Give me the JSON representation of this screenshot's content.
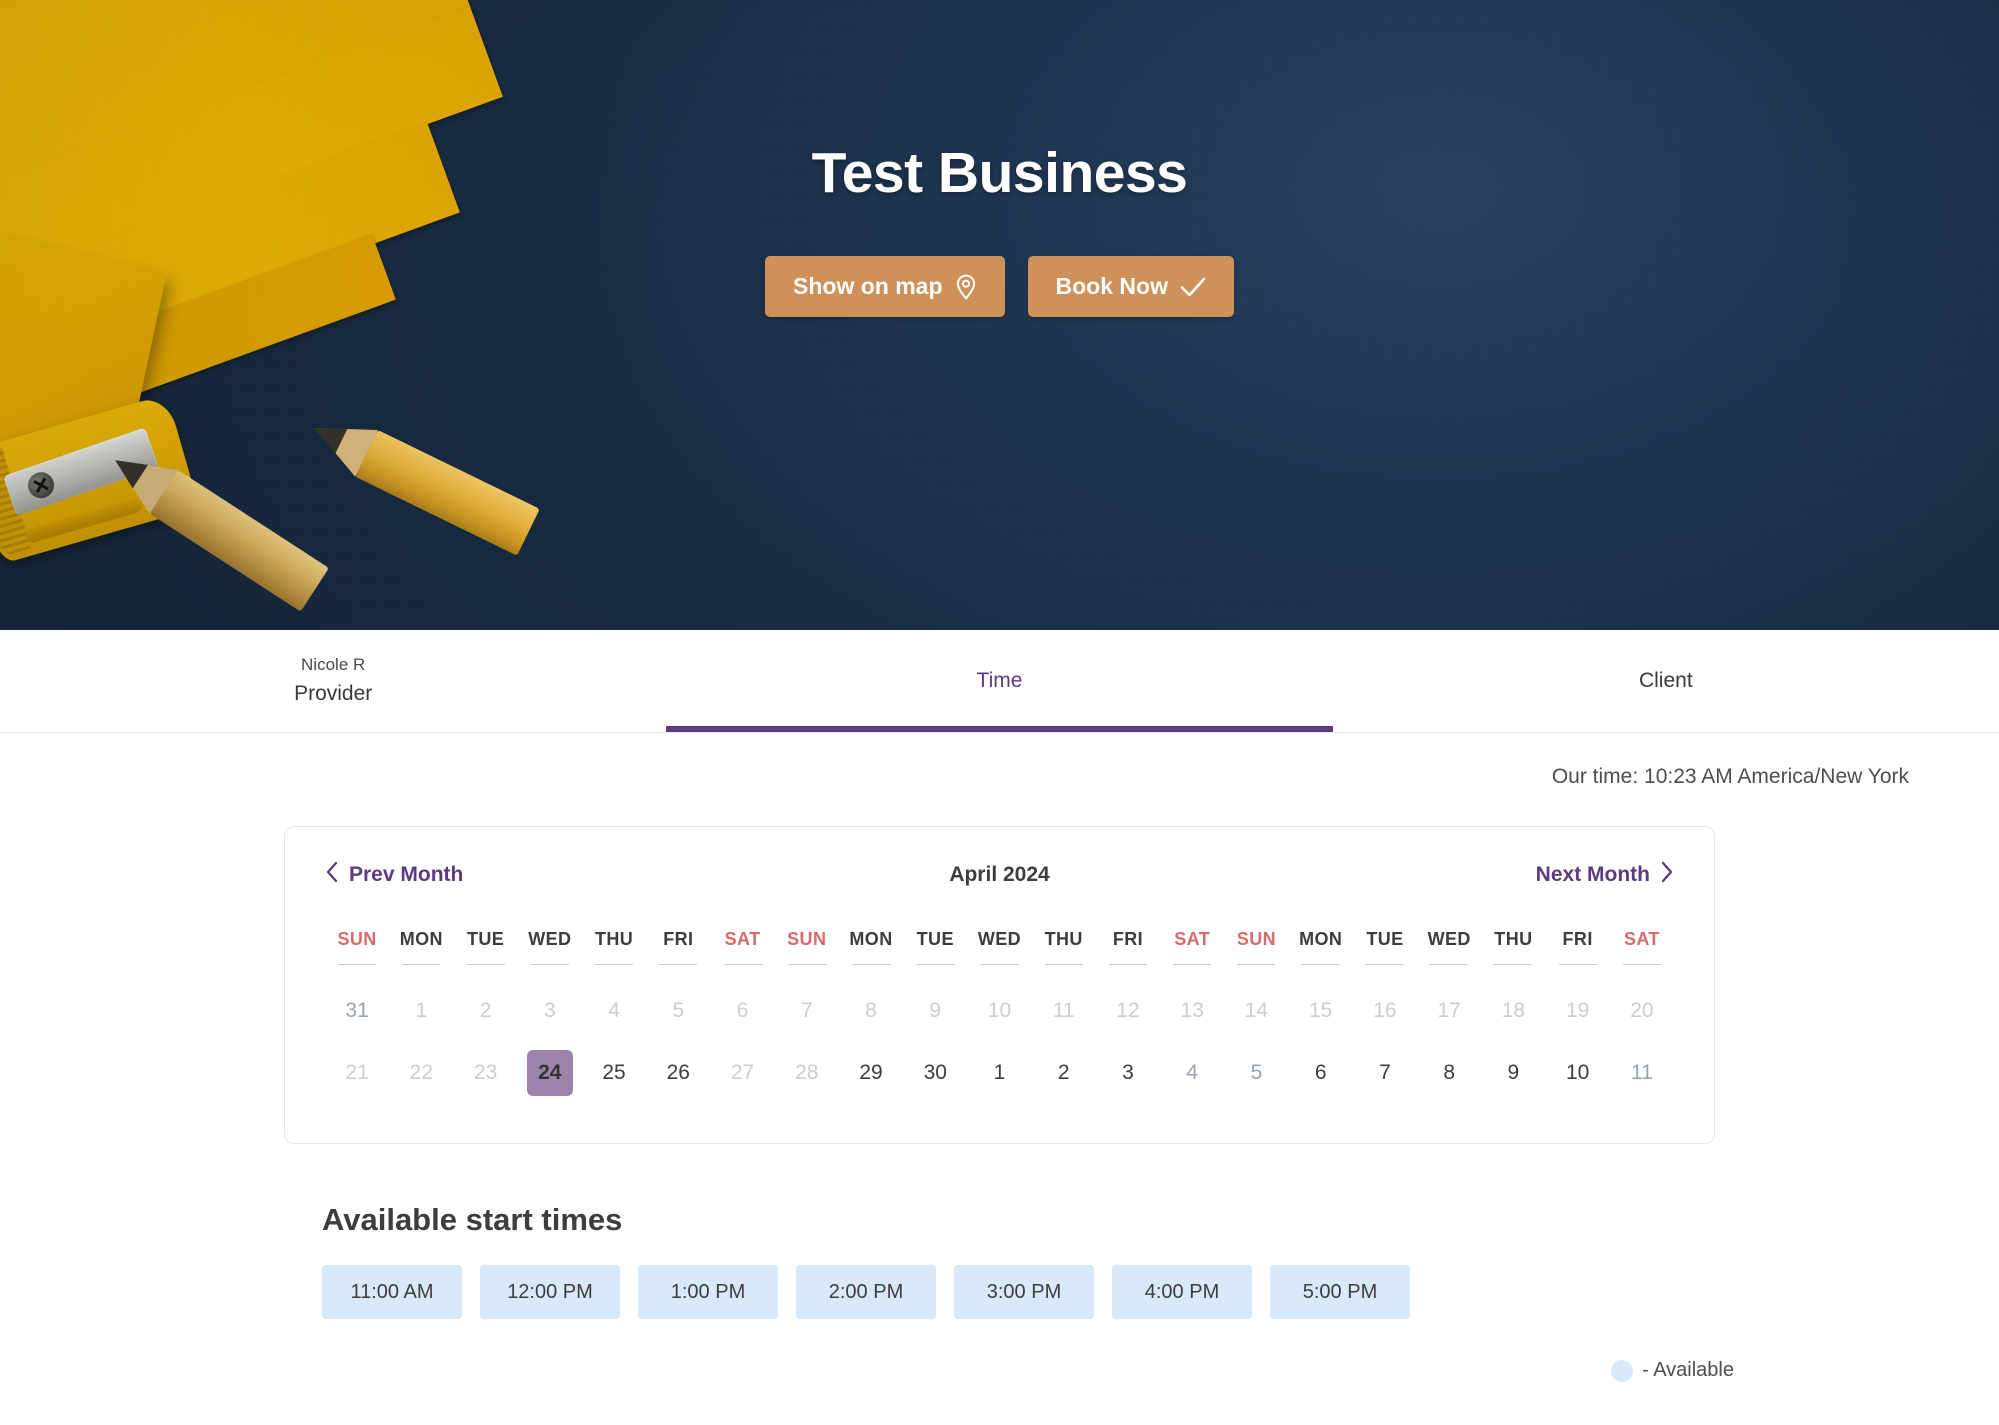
{
  "hero": {
    "title": "Test Business",
    "buttons": [
      {
        "label": "Show on map",
        "icon": "map-pin-icon"
      },
      {
        "label": "Book Now",
        "icon": "check-icon"
      }
    ],
    "background_color": "#1f3653",
    "button_color": "#cd9159"
  },
  "tabs": {
    "accent_color": "#5c3b80",
    "items": [
      {
        "sub": "Nicole R",
        "label": "Provider",
        "active": false
      },
      {
        "sub": "",
        "label": "Time",
        "active": true
      },
      {
        "sub": "",
        "label": "Client",
        "active": false
      }
    ]
  },
  "our_time": "Our time: 10:23 AM America/New York",
  "calendar": {
    "prev_label": "Prev Month",
    "next_label": "Next Month",
    "month": "April 2024",
    "selected_day": "24",
    "selected_color": "#9b83ab",
    "weekend_color": "#d96a6a",
    "day_headers": [
      "SUN",
      "MON",
      "TUE",
      "WED",
      "THU",
      "FRI",
      "SAT",
      "SUN",
      "MON",
      "TUE",
      "WED",
      "THU",
      "FRI",
      "SAT",
      "SUN",
      "MON",
      "TUE",
      "WED",
      "THU",
      "FRI",
      "SAT"
    ],
    "rows": [
      [
        {
          "n": "31",
          "state": "dim-strong"
        },
        {
          "n": "1",
          "state": "dim"
        },
        {
          "n": "2",
          "state": "dim"
        },
        {
          "n": "3",
          "state": "dim"
        },
        {
          "n": "4",
          "state": "dim"
        },
        {
          "n": "5",
          "state": "dim"
        },
        {
          "n": "6",
          "state": "dim"
        },
        {
          "n": "7",
          "state": "dim"
        },
        {
          "n": "8",
          "state": "dim"
        },
        {
          "n": "9",
          "state": "dim"
        },
        {
          "n": "10",
          "state": "dim"
        },
        {
          "n": "11",
          "state": "dim"
        },
        {
          "n": "12",
          "state": "dim"
        },
        {
          "n": "13",
          "state": "dim"
        },
        {
          "n": "14",
          "state": "dim"
        },
        {
          "n": "15",
          "state": "dim"
        },
        {
          "n": "16",
          "state": "dim"
        },
        {
          "n": "17",
          "state": "dim"
        },
        {
          "n": "18",
          "state": "dim"
        },
        {
          "n": "19",
          "state": "dim"
        },
        {
          "n": "20",
          "state": "dim"
        }
      ],
      [
        {
          "n": "21",
          "state": "dim"
        },
        {
          "n": "22",
          "state": "dim"
        },
        {
          "n": "23",
          "state": "dim"
        },
        {
          "n": "24",
          "state": "selected"
        },
        {
          "n": "25",
          "state": "enabled"
        },
        {
          "n": "26",
          "state": "enabled"
        },
        {
          "n": "27",
          "state": "dim"
        },
        {
          "n": "28",
          "state": "dim"
        },
        {
          "n": "29",
          "state": "enabled"
        },
        {
          "n": "30",
          "state": "enabled"
        },
        {
          "n": "1",
          "state": "enabled"
        },
        {
          "n": "2",
          "state": "enabled"
        },
        {
          "n": "3",
          "state": "enabled"
        },
        {
          "n": "4",
          "state": "dim-strong"
        },
        {
          "n": "5",
          "state": "dim-strong"
        },
        {
          "n": "6",
          "state": "enabled"
        },
        {
          "n": "7",
          "state": "enabled"
        },
        {
          "n": "8",
          "state": "enabled"
        },
        {
          "n": "9",
          "state": "enabled"
        },
        {
          "n": "10",
          "state": "enabled"
        },
        {
          "n": "11",
          "state": "dim-strong"
        }
      ]
    ]
  },
  "times": {
    "title": "Available start times",
    "chip_color": "#d7e9fb",
    "slots": [
      "11:00 AM",
      "12:00 PM",
      "1:00 PM",
      "2:00 PM",
      "3:00 PM",
      "4:00 PM",
      "5:00 PM"
    ]
  },
  "legend": {
    "text": "- Available",
    "dot_color": "#d7e9fb"
  }
}
